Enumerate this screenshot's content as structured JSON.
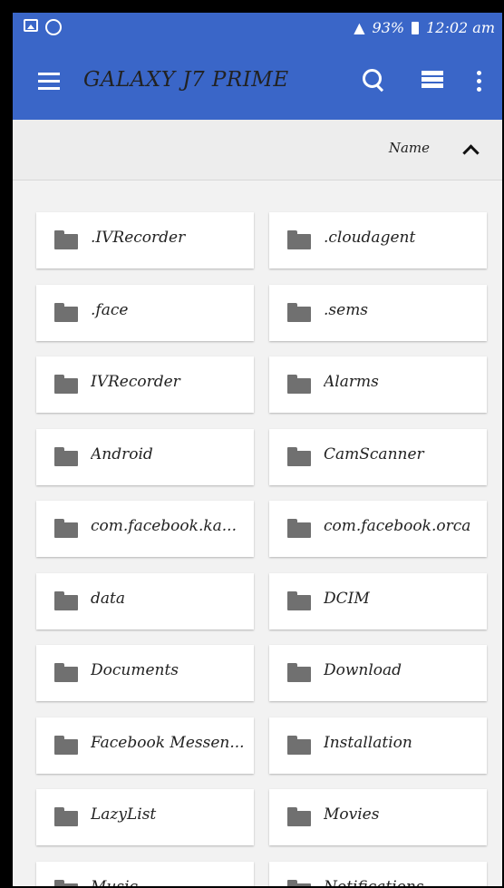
{
  "status_bar": {
    "battery_percent": "93%",
    "time": "12:02 am",
    "icons_left": [
      "gallery-icon",
      "whatsapp-icon"
    ],
    "icons_right": [
      "sim-icon",
      "mute-icon",
      "wifi-icon",
      "signal-icon",
      "battery-icon"
    ]
  },
  "toolbar": {
    "title": "GALAXY J7 PRIME",
    "icons": [
      "menu-icon",
      "search-icon",
      "list-view-icon",
      "more-icon"
    ]
  },
  "sort": {
    "label": "Name",
    "direction_icon": "chevron-up-icon"
  },
  "folders": [
    ".IVRecorder",
    ".cloudagent",
    ".face",
    ".sems",
    "IVRecorder",
    "Alarms",
    "Android",
    "CamScanner",
    "com.facebook.ka...",
    "com.facebook.orca",
    "data",
    "DCIM",
    "Documents",
    "Download",
    "Facebook Messen...",
    "Installation",
    "LazyList",
    "Movies",
    "Music",
    "Notifications"
  ],
  "colors": {
    "accent": "#3a66c8",
    "background": "#f2f2f2",
    "folder_icon": "#707070"
  }
}
